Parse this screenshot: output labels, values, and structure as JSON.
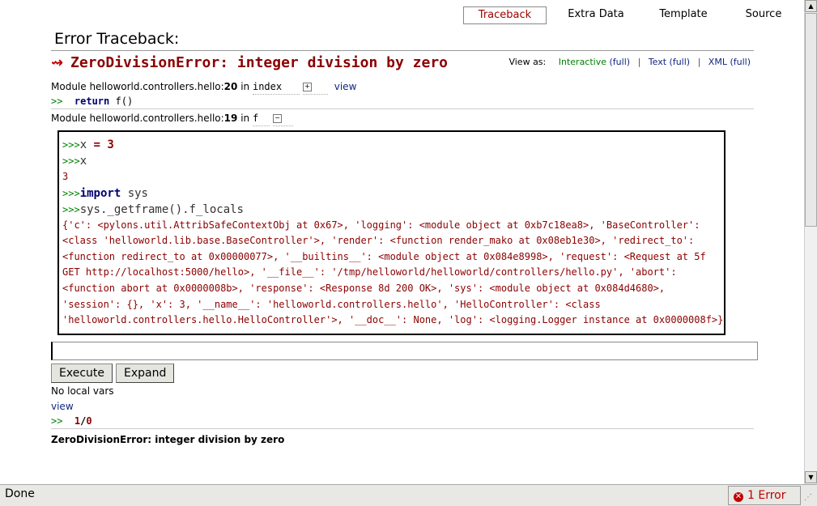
{
  "tabs": [
    {
      "label": "Traceback",
      "active": true
    },
    {
      "label": "Extra Data",
      "active": false
    },
    {
      "label": "Template",
      "active": false
    },
    {
      "label": "Source",
      "active": false
    }
  ],
  "page_title": "Error Traceback:",
  "error": {
    "arrow": "⇝",
    "title": "ZeroDivisionError: integer division by zero"
  },
  "view_as": {
    "label": "View as:",
    "interactive": "Interactive",
    "interactive_full": "(full)",
    "text": "Text",
    "text_full": "(full)",
    "xml": "XML",
    "xml_full": "(full)",
    "sep": "|"
  },
  "frames": [
    {
      "module_prefix": "Module helloworld.controllers.hello:",
      "line": "20",
      "in_label": "in",
      "func": "index",
      "toggle": "+",
      "view_label": "view",
      "code_prompt": ">>",
      "code_kw": "return",
      "code_rest": " f()"
    },
    {
      "module_prefix": "Module helloworld.controllers.hello:",
      "line": "19",
      "in_label": "in",
      "func": "f",
      "toggle": "−"
    }
  ],
  "console": {
    "prompt": ">>>",
    "lines": [
      {
        "kind": "input",
        "code": "x",
        "op": " = ",
        "num": "3"
      },
      {
        "kind": "input",
        "code": "x"
      },
      {
        "kind": "output",
        "text": "3"
      },
      {
        "kind": "input",
        "kw": "import",
        "code": " sys"
      },
      {
        "kind": "input",
        "code": "sys._getframe().f_locals"
      },
      {
        "kind": "output",
        "text": "{'c': <pylons.util.AttribSafeContextObj at 0x67>, 'logging': <module object at 0xb7c18ea8>, 'BaseController': <class 'helloworld.lib.base.BaseController'>, 'render': <function render_mako at 0x08eb1e30>, 'redirect_to': <function redirect_to at 0x00000077>, '__builtins__': <module object at 0x084e8998>, 'request': <Request at 5f GET http://localhost:5000/hello>, '__file__': '/tmp/helloworld/helloworld/controllers/hello.py', 'abort': <function abort at 0x0000008b>, 'response': <Response 8d 200 OK>, 'sys': <module object at 0x084d4680>, 'session': {}, 'x': 3, '__name__': 'helloworld.controllers.hello', 'HelloController': <class 'helloworld.controllers.hello.HelloController'>, '__doc__': None, 'log': <logging.Logger instance at 0x0000008f>}"
      }
    ],
    "input_value": ""
  },
  "buttons": {
    "execute": "Execute",
    "expand": "Expand"
  },
  "no_local_vars": "No local vars",
  "view_label": "view",
  "last_code": {
    "prompt": ">>",
    "num1": "1",
    "op": "/",
    "num2": "0"
  },
  "final_error": "ZeroDivisionError: integer division by zero",
  "statusbar": {
    "text": "Done",
    "error_count": "1 Error",
    "error_icon": "✕"
  },
  "colors": {
    "error_red": "#8b0000",
    "link_navy": "#102680",
    "prompt_green": "#008000"
  }
}
